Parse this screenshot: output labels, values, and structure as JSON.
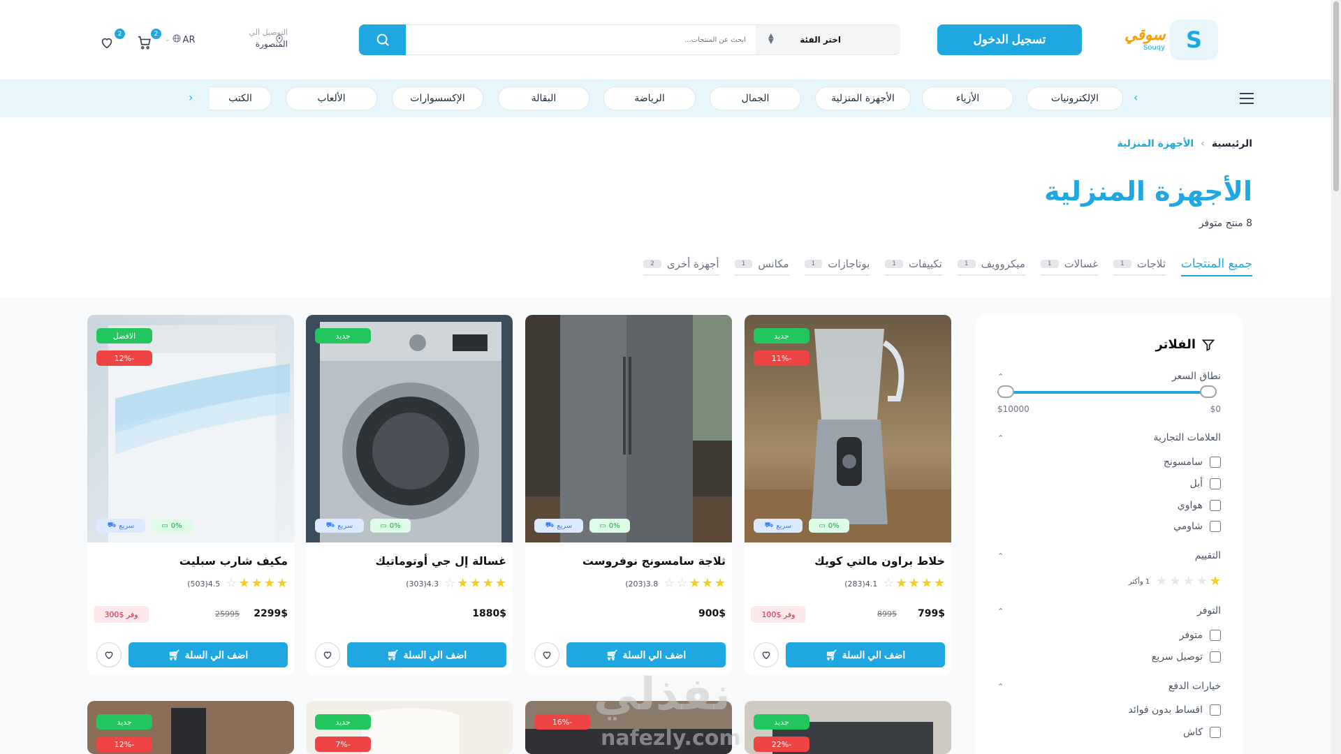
{
  "header": {
    "logo_letter": "S",
    "logo_ar": "سوقي",
    "logo_en": "Souqy",
    "login_label": "تسجيل الدخول",
    "search_placeholder": "ابحث عن المنتجات...",
    "category_select": "اختر الفئة",
    "deliver_label": "التوصيل الي",
    "deliver_city": "المنصورة",
    "lang": "AR",
    "cart_count": "2",
    "wish_count": "2"
  },
  "nav": {
    "categories": [
      "الإلكترونيات",
      "الأزياء",
      "الأجهزة المنزلية",
      "الجمال",
      "الرياضة",
      "البقالة",
      "الإكسسوارات",
      "الألعاب",
      "الكتب"
    ]
  },
  "breadcrumb": {
    "home": "الرئيسية",
    "sep": "›",
    "current": "الأجهزة المنزلية"
  },
  "page": {
    "title": "الأجهزة المنزلية",
    "available": "8 منتج متوفر"
  },
  "tabs": [
    {
      "label": "جميع المنتجات",
      "count": ""
    },
    {
      "label": "ثلاجات",
      "count": "1"
    },
    {
      "label": "غسالات",
      "count": "1"
    },
    {
      "label": "ميكروويف",
      "count": "1"
    },
    {
      "label": "تكييفات",
      "count": "1"
    },
    {
      "label": "بوتاجازات",
      "count": "1"
    },
    {
      "label": "مكانس",
      "count": "1"
    },
    {
      "label": "أجهزة أخرى",
      "count": "2"
    }
  ],
  "filters": {
    "title": "الفلاتر",
    "price_title": "نطاق السعر",
    "price_min": "$0",
    "price_max": "$10000",
    "brands_title": "العلامات التجارية",
    "brands": [
      "سامسونج",
      "أبل",
      "هواوي",
      "شاومي"
    ],
    "rating_title": "التقييم",
    "rating_label": "1 وأكثر",
    "availability_title": "التوفر",
    "availability": [
      "متوفر",
      "توصيل سريع"
    ],
    "payment_title": "خيارات الدفع",
    "payment": [
      "اقساط بدون فوائد",
      "كاش"
    ]
  },
  "products": [
    {
      "name": "خلاط براون مالتي كويك",
      "rating": "4.1",
      "reviews": "(283)",
      "stars": 4,
      "price": "799$",
      "old_price": "8995",
      "save": "وفر $100",
      "badge1": "جديد",
      "badge2": "-11%",
      "fast": "سريع",
      "installment": "0%",
      "add": "اضف الي السلة"
    },
    {
      "name": "ثلاجة سامسونج نوفروست",
      "rating": "3.8",
      "reviews": "(203)",
      "stars": 3,
      "price": "900$",
      "old_price": "",
      "save": "",
      "badge1": "",
      "badge2": "",
      "fast": "سريع",
      "installment": "0%",
      "add": "اضف الي السلة"
    },
    {
      "name": "غسالة إل جي أوتوماتيك",
      "rating": "4.3",
      "reviews": "(303)",
      "stars": 4,
      "price": "1880$",
      "old_price": "",
      "save": "",
      "badge1": "جديد",
      "badge2": "",
      "fast": "سريع",
      "installment": "0%",
      "add": "اضف الي السلة"
    },
    {
      "name": "مكيف شارب سبليت",
      "rating": "4.5",
      "reviews": "(503)",
      "stars": 4,
      "price": "2299$",
      "old_price": "25995",
      "save": "وفر $300",
      "badge1": "الافضل",
      "badge2": "-12%",
      "fast": "سريع",
      "installment": "0%",
      "add": "اضف الي السلة"
    }
  ],
  "products_row2": [
    {
      "badge1": "جديد",
      "badge2": "-22%"
    },
    {
      "badge1": "",
      "badge2": "-16%"
    },
    {
      "badge1": "جديد",
      "badge2": "-7%"
    },
    {
      "badge1": "جديد",
      "badge2": "-12%"
    }
  ],
  "watermark": {
    "ar": "نفذلي",
    "en": "nafezly.com"
  },
  "colors": {
    "accent": "#1ea7e1",
    "green": "#22c55e",
    "red": "#ef4444",
    "star": "#facc15"
  }
}
